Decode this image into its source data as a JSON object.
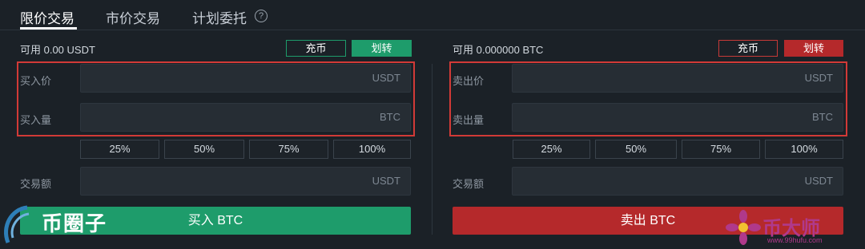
{
  "tabs": [
    {
      "label": "限价交易",
      "active": true
    },
    {
      "label": "市价交易",
      "active": false
    },
    {
      "label": "计划委托",
      "active": false
    }
  ],
  "help_icon": "question-circle-icon",
  "buy": {
    "available": "可用 0.00 USDT",
    "deposit_label": "充币",
    "transfer_label": "划转",
    "price_label": "买入价",
    "price_unit": "USDT",
    "amount_label": "买入量",
    "amount_unit": "BTC",
    "percents": [
      "25%",
      "50%",
      "75%",
      "100%"
    ],
    "total_label": "交易额",
    "total_unit": "USDT",
    "action_label": "买入 BTC",
    "accent": "#1e9c6b"
  },
  "sell": {
    "available": "可用 0.000000 BTC",
    "deposit_label": "充币",
    "transfer_label": "划转",
    "price_label": "卖出价",
    "price_unit": "USDT",
    "amount_label": "卖出量",
    "amount_unit": "BTC",
    "percents": [
      "25%",
      "50%",
      "75%",
      "100%"
    ],
    "total_label": "交易额",
    "total_unit": "USDT",
    "action_label": "卖出 BTC",
    "accent": "#b5292b"
  },
  "watermarks": {
    "left": "币圈子",
    "right": "币大师",
    "right_url": "www.99hufu.com"
  }
}
